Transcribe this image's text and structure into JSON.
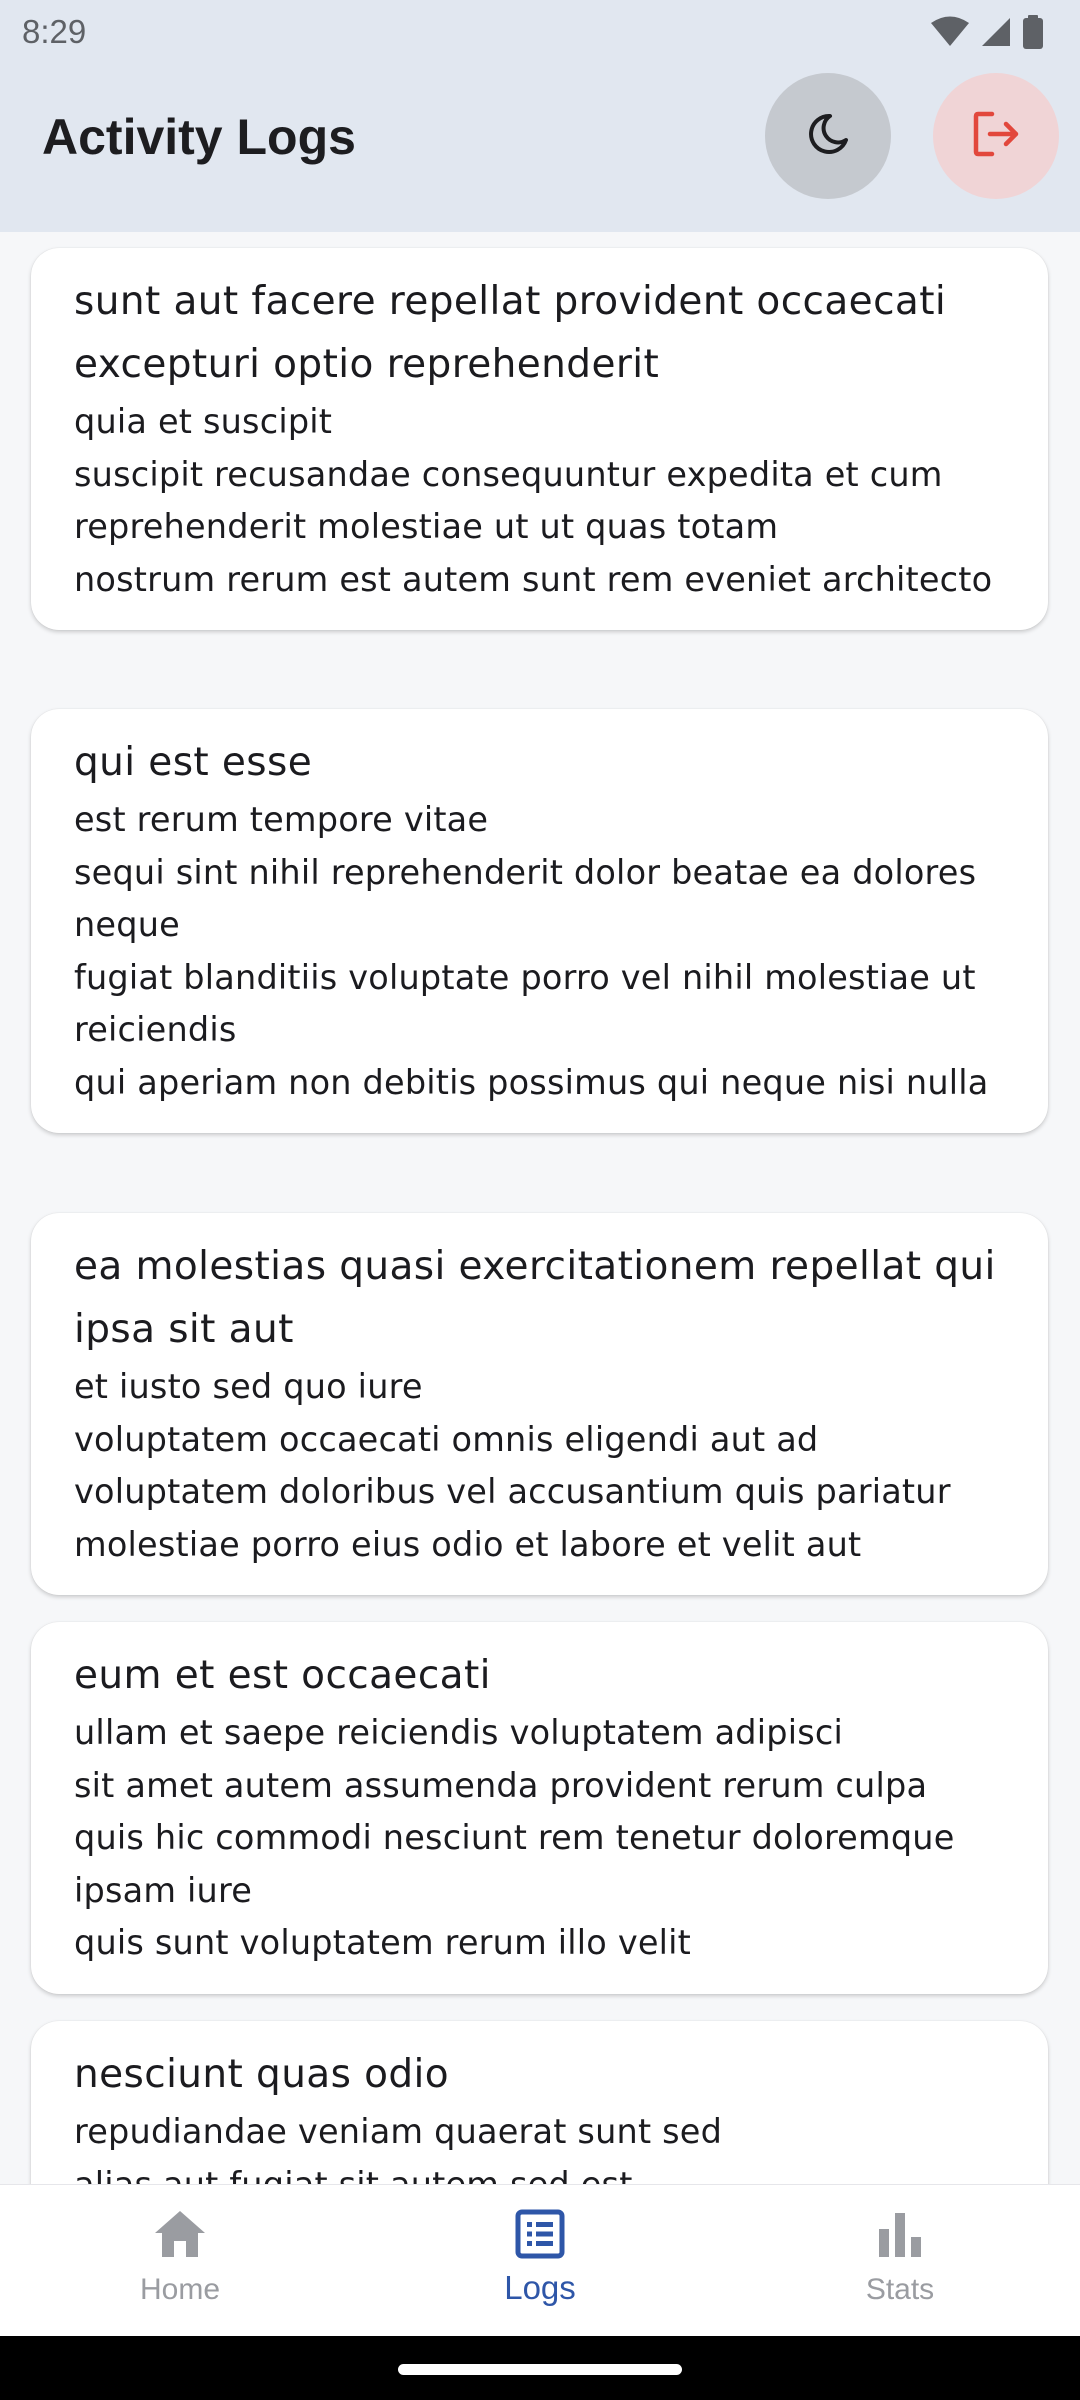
{
  "status_bar": {
    "time": "8:29"
  },
  "app_bar": {
    "title": "Activity Logs",
    "theme_icon": "moon-icon",
    "logout_icon": "logout-icon",
    "logout_color": "#e2473c"
  },
  "logs": [
    {
      "title": "sunt aut facere repellat provident occaecati excepturi optio reprehenderit",
      "body": "quia et suscipit\nsuscipit recusandae consequuntur expedita et cum reprehenderit molestiae ut ut quas totam\nnostrum rerum est autem sunt rem eveniet architecto"
    },
    {
      "title": "qui est esse",
      "body": "est rerum tempore vitae\nsequi sint nihil reprehenderit dolor beatae ea dolores neque\nfugiat blanditiis voluptate porro vel nihil molestiae ut reiciendis\nqui aperiam non debitis possimus qui neque nisi nulla"
    },
    {
      "title": "ea molestias quasi exercitationem repellat qui ipsa sit aut",
      "body": "et iusto sed quo iure\nvoluptatem occaecati omnis eligendi aut ad\nvoluptatem doloribus vel accusantium quis pariatur\nmolestiae porro eius odio et labore et velit aut"
    },
    {
      "title": "eum et est occaecati",
      "body": "ullam et saepe reiciendis voluptatem adipisci\nsit amet autem assumenda provident rerum culpa\nquis hic commodi nesciunt rem tenetur doloremque ipsam iure\nquis sunt voluptatem rerum illo velit"
    },
    {
      "title": "nesciunt quas odio",
      "body": "repudiandae veniam quaerat sunt sed\nalias aut fugiat sit autem sed est"
    }
  ],
  "bottom_nav": {
    "items": [
      {
        "label": "Home",
        "icon": "home-icon",
        "active": false
      },
      {
        "label": "Logs",
        "icon": "list-icon",
        "active": true
      },
      {
        "label": "Stats",
        "icon": "bar-chart-icon",
        "active": false
      }
    ],
    "active_color": "#2e56a8",
    "inactive_color": "#9a9ca1"
  }
}
